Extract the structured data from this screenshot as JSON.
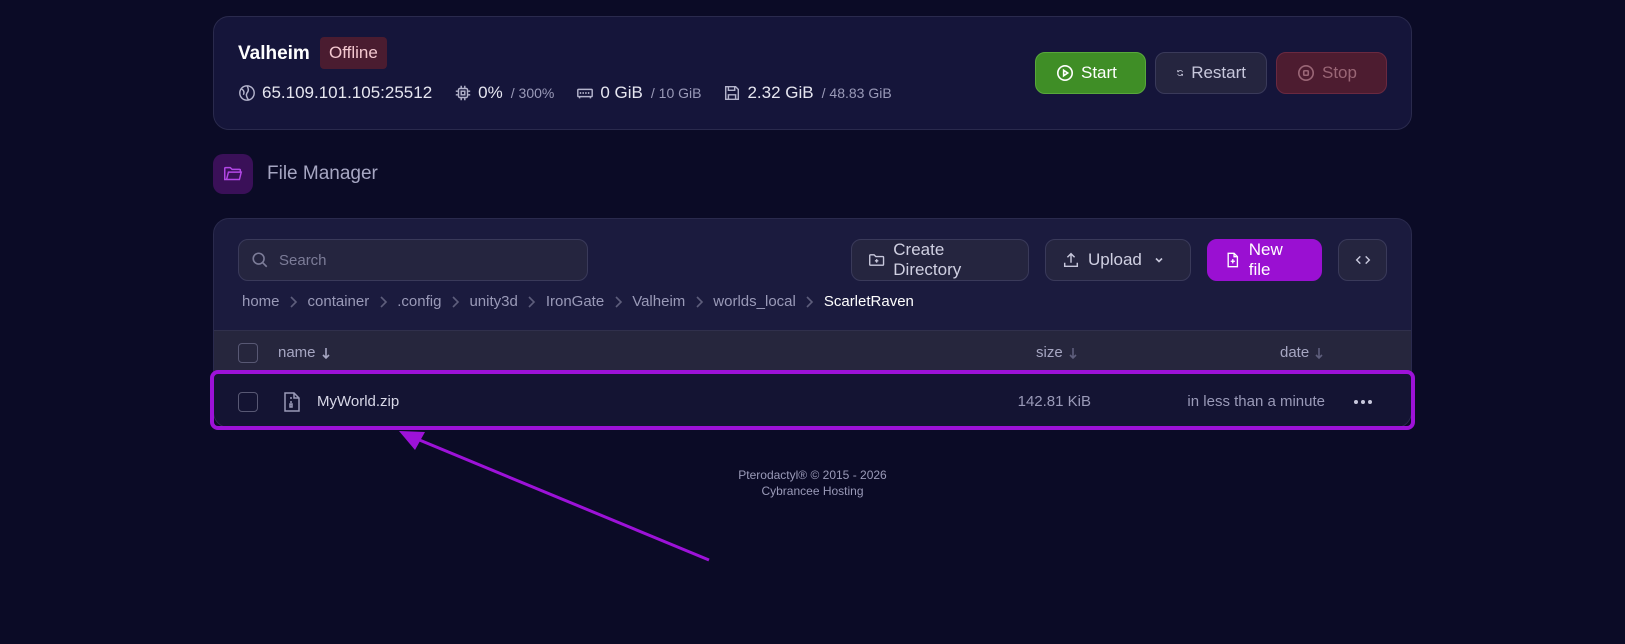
{
  "server": {
    "name": "Valheim",
    "status": "Offline",
    "address": "65.109.101.105:25512",
    "cpu": {
      "value": "0%",
      "limit": "/ 300%"
    },
    "memory": {
      "value": "0 GiB",
      "limit": "/ 10 GiB"
    },
    "disk": {
      "value": "2.32 GiB",
      "limit": "/ 48.83 GiB"
    },
    "buttons": {
      "start": "Start",
      "restart": "Restart",
      "stop": "Stop"
    }
  },
  "file_manager": {
    "title": "File Manager",
    "search_placeholder": "Search",
    "buttons": {
      "create_directory": "Create Directory",
      "upload": "Upload",
      "new_file": "New file"
    },
    "breadcrumb": [
      "home",
      "container",
      ".config",
      "unity3d",
      "IronGate",
      "Valheim",
      "worlds_local",
      "ScarletRaven"
    ],
    "columns": {
      "name": "name",
      "size": "size",
      "date": "date"
    },
    "files": [
      {
        "name": "MyWorld.zip",
        "size": "142.81 KiB",
        "date": "in less than a minute"
      }
    ]
  },
  "footer": {
    "line1": "Pterodactyl® © 2015 - 2026",
    "line2": "Cybrancee Hosting"
  },
  "colors": {
    "background": "#0b0b26",
    "accent": "#9a10d2",
    "start": "#3f8e26",
    "stop": "#4d1c30",
    "annotation": "#9d12d8"
  }
}
